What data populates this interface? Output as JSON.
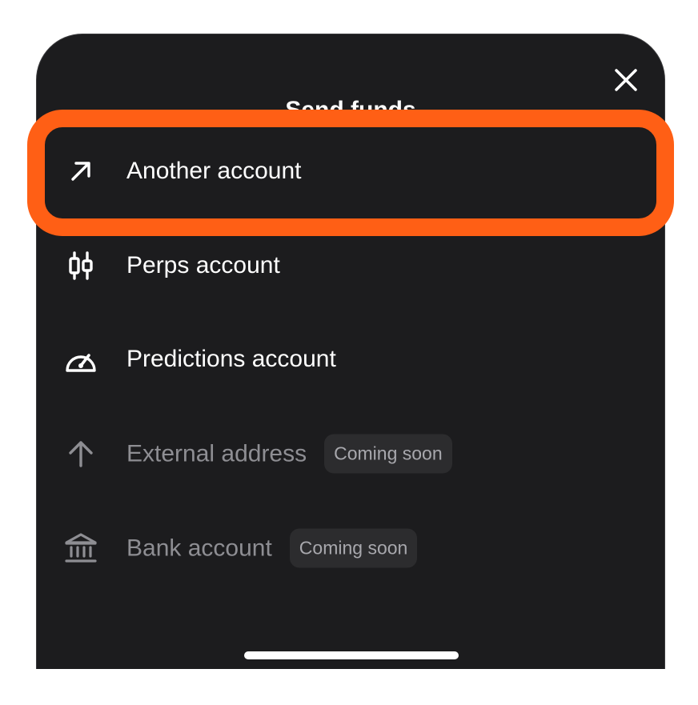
{
  "sheet": {
    "title": "Send funds",
    "close_icon": "close-icon"
  },
  "options": [
    {
      "label": "Another account",
      "icon": "arrow-up-right-icon",
      "highlighted": true
    },
    {
      "label": "Perps account",
      "icon": "candlestick-icon"
    },
    {
      "label": "Predictions account",
      "icon": "gauge-icon"
    },
    {
      "label": "External address",
      "icon": "arrow-up-icon",
      "badge": "Coming soon",
      "disabled": true
    },
    {
      "label": "Bank account",
      "icon": "bank-icon",
      "badge": "Coming soon",
      "disabled": true
    }
  ],
  "colors": {
    "sheet_background": "#1c1c1e",
    "highlight_outline": "#ff5f15",
    "disabled_text": "#8e8e93"
  }
}
